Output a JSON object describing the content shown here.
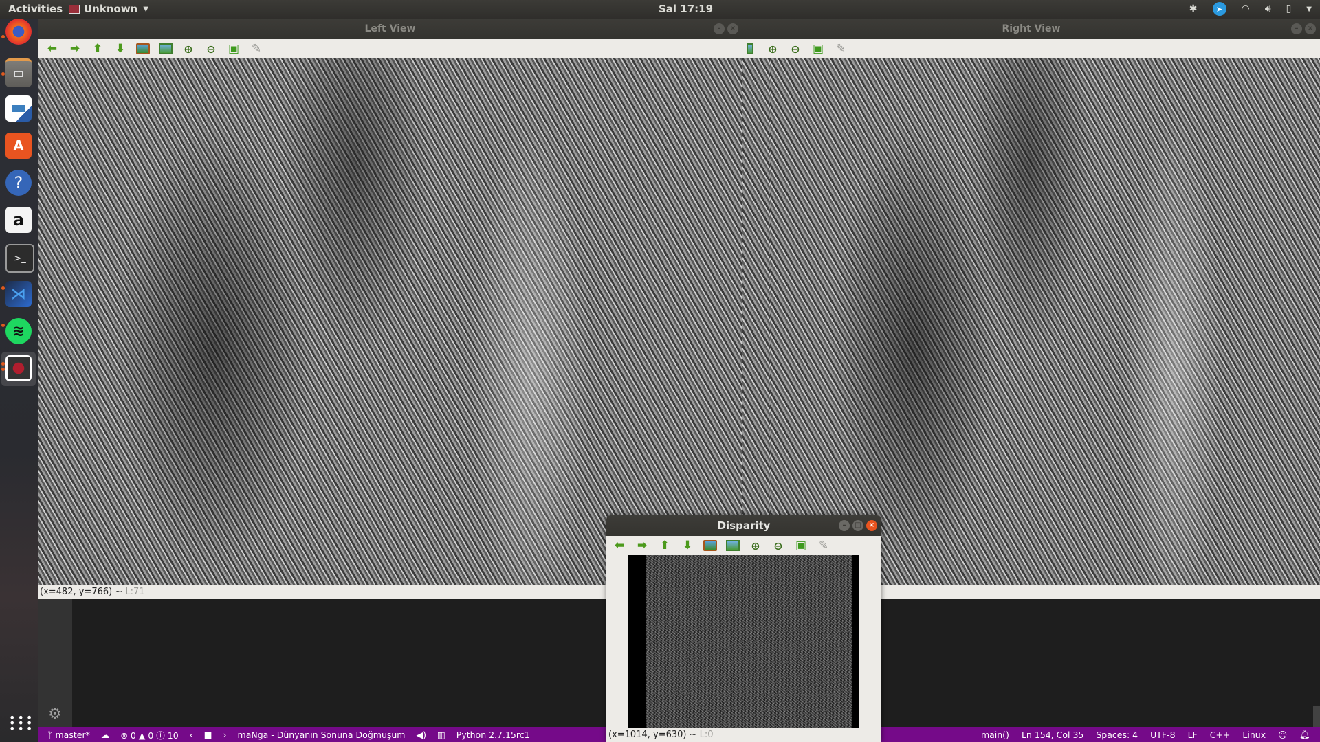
{
  "topbar": {
    "activities": "Activities",
    "app_name": "Unknown",
    "clock": "Sal 17:19",
    "tray_icons": [
      "bluetooth-icon",
      "telegram-icon",
      "wifi-icon",
      "volume-icon",
      "battery-icon",
      "system-menu-icon"
    ]
  },
  "dock": {
    "items": [
      {
        "name": "firefox",
        "running": true
      },
      {
        "name": "files",
        "running": true
      },
      {
        "name": "libreoffice-impress",
        "running": false
      },
      {
        "name": "ubuntu-software",
        "running": false
      },
      {
        "name": "help",
        "running": false
      },
      {
        "name": "amazon",
        "running": false
      },
      {
        "name": "terminal",
        "running": false
      },
      {
        "name": "vscode",
        "running": true
      },
      {
        "name": "spotify",
        "running": true
      },
      {
        "name": "opencv-window",
        "running": true,
        "active": true
      }
    ],
    "show_apps": "show-applications"
  },
  "toolbar_icons": [
    "pan-left",
    "pan-right",
    "pan-up",
    "pan-down",
    "zoom-original",
    "zoom-fit",
    "zoom-in",
    "zoom-out",
    "save",
    "properties"
  ],
  "left_view": {
    "title": "Left View",
    "status_coords": "(x=482, y=766) ~ ",
    "status_level": "L:71"
  },
  "right_view": {
    "title": "Right View"
  },
  "disparity": {
    "title": "Disparity",
    "status_coords": "(x=1014, y=630) ~ ",
    "status_level": "L:0"
  },
  "vscode_status": {
    "branch": "master*",
    "errors": "0",
    "warnings": "0",
    "infos": "10",
    "now_playing": "maNga - Dünyanın Sonuna Doğmuşum",
    "interpreter": "Python 2.7.15rc1",
    "function": "main()",
    "position": "Ln 154, Col 35",
    "indent": "Spaces: 4",
    "encoding": "UTF-8",
    "eol": "LF",
    "language": "C++",
    "platform": "Linux"
  }
}
